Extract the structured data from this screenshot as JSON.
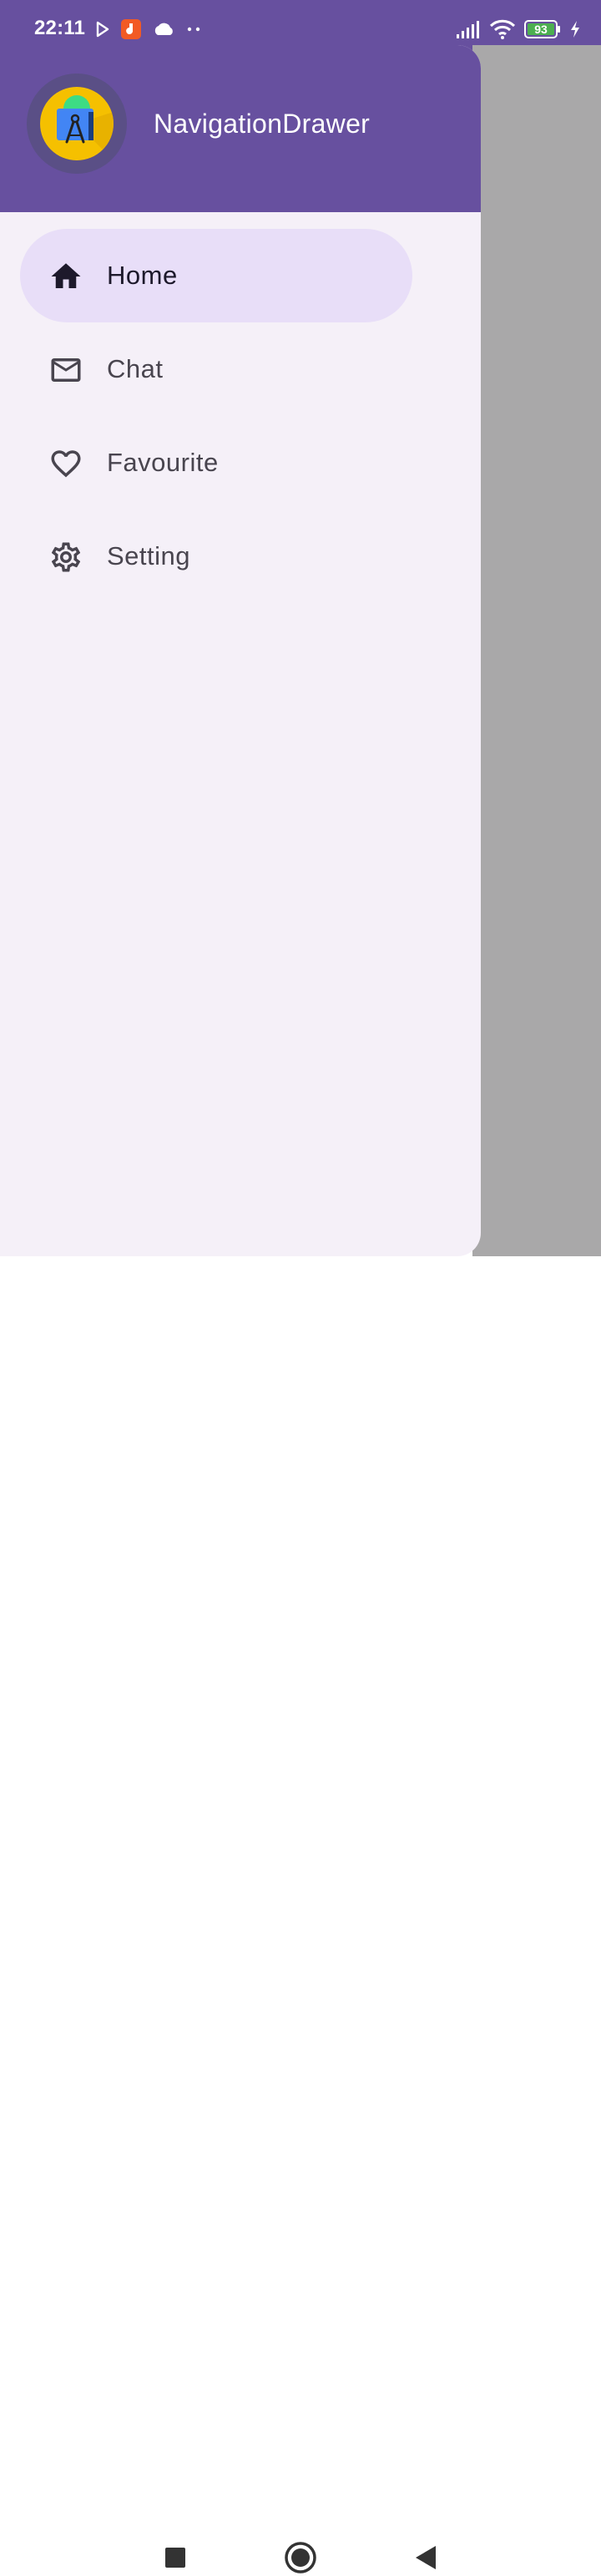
{
  "status_bar": {
    "time": "22:11",
    "battery": "93",
    "icons": [
      "play-store-icon",
      "app-notification-icon",
      "cloud-icon",
      "more-dots-icon",
      "signal-icon",
      "wifi-icon",
      "battery-icon",
      "charging-icon"
    ]
  },
  "drawer": {
    "header_title": "NavigationDrawer",
    "header_color": "#67509f",
    "items": [
      {
        "label": "Home",
        "icon": "home-icon",
        "selected": true
      },
      {
        "label": "Chat",
        "icon": "mail-icon",
        "selected": false
      },
      {
        "label": "Favourite",
        "icon": "heart-icon",
        "selected": false
      },
      {
        "label": "Setting",
        "icon": "gear-icon",
        "selected": false
      }
    ]
  },
  "colors": {
    "accent": "#67509f",
    "selected_bg": "#e8def8",
    "drawer_bg": "#f5f0f8",
    "scrim": "#a9a8a9"
  },
  "navigation_bar": {
    "buttons": [
      "recents-button",
      "home-button",
      "back-button"
    ]
  }
}
